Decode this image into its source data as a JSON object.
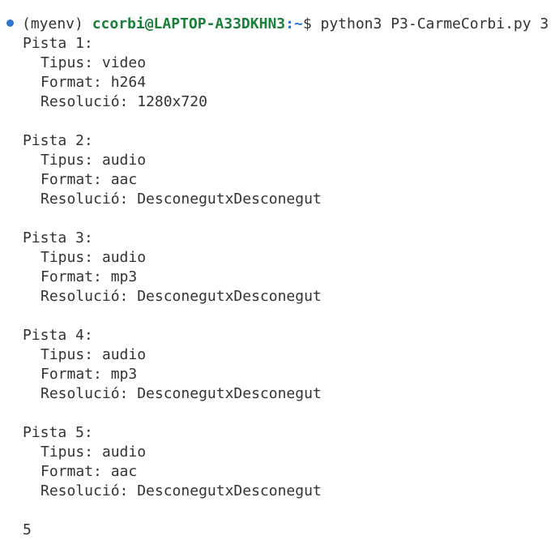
{
  "prompt": {
    "venv": "(myenv)",
    "user_host": "ccorbi@LAPTOP-A33DKHN3",
    "separator": ":",
    "path": "~",
    "symbol": "$",
    "command": "python3 P3-CarmeCorbi.py 3"
  },
  "output": {
    "tracks": [
      {
        "header": "Pista 1:",
        "type": "Tipus: video",
        "format": "Format: h264",
        "resolution": "Resolució: 1280x720"
      },
      {
        "header": "Pista 2:",
        "type": "Tipus: audio",
        "format": "Format: aac",
        "resolution": "Resolució: DesconegutxDesconegut"
      },
      {
        "header": "Pista 3:",
        "type": "Tipus: audio",
        "format": "Format: mp3",
        "resolution": "Resolució: DesconegutxDesconegut"
      },
      {
        "header": "Pista 4:",
        "type": "Tipus: audio",
        "format": "Format: mp3",
        "resolution": "Resolució: DesconegutxDesconegut"
      },
      {
        "header": "Pista 5:",
        "type": "Tipus: audio",
        "format": "Format: aac",
        "resolution": "Resolució: DesconegutxDesconegut"
      }
    ],
    "result": "5"
  },
  "colors": {
    "status_dot": "#2f74d0",
    "user_host": "#188038",
    "path": "#2f74d0",
    "text": "#333333"
  }
}
